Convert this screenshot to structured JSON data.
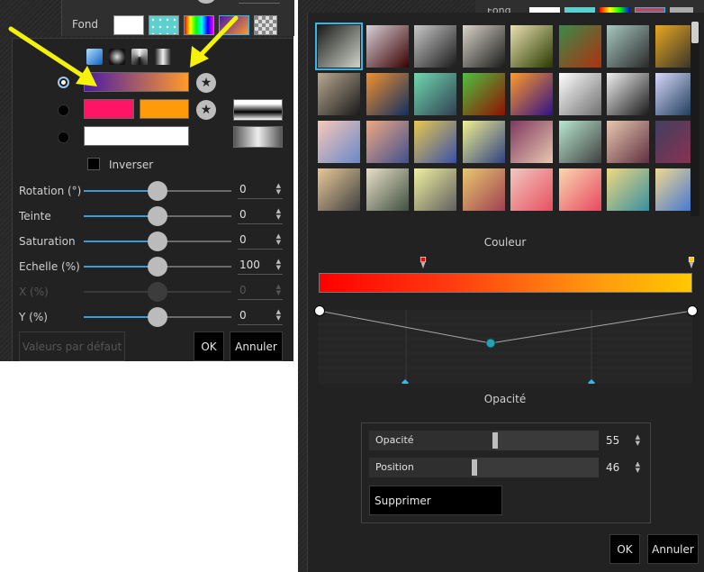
{
  "left": {
    "background_label": "Fond",
    "gradient_types": [
      "linear-gradient-icon",
      "radial-gradient-icon",
      "conical-gradient-icon",
      "reflected-gradient-icon"
    ],
    "invert_label": "Inverser",
    "sliders": [
      {
        "label": "Rotation (°)",
        "value": "0",
        "fraction": 0.5,
        "enabled": true
      },
      {
        "label": "Teinte",
        "value": "0",
        "fraction": 0.5,
        "enabled": true
      },
      {
        "label": "Saturation",
        "value": "0",
        "fraction": 0.5,
        "enabled": true
      },
      {
        "label": "Echelle (%)",
        "value": "100",
        "fraction": 0.5,
        "enabled": true
      },
      {
        "label": "X (%)",
        "value": "0",
        "fraction": 0.5,
        "enabled": false
      },
      {
        "label": "Y (%)",
        "value": "0",
        "fraction": 0.5,
        "enabled": true
      }
    ],
    "default_button": "Valeurs par défaut",
    "ok_button": "OK",
    "cancel_button": "Annuler",
    "colors": {
      "gradient_start": "#4a1aa8",
      "gradient_end": "#ff9a2a",
      "color_pink": "#ff1466",
      "color_orange": "#ff9a0a",
      "slider_accent": "#3b9bd8",
      "arrow": "#f5f20a"
    }
  },
  "right": {
    "color_label": "Couleur",
    "opacity_label": "Opacité",
    "stop_props": {
      "opacity_label": "Opacité",
      "opacity_value": "55",
      "opacity_fraction": 0.55,
      "position_label": "Position",
      "position_value": "46",
      "position_fraction": 0.46
    },
    "delete_button": "Supprimer",
    "ok_button": "OK",
    "cancel_button": "Annuler",
    "gradient_stops": [
      "#ff0000",
      "#ffc800"
    ],
    "presets": [
      [
        "#cfd4c8",
        "#1a1a1a"
      ],
      [
        "#3a0000",
        "#d8d0d8"
      ],
      [
        "#1a1a1a",
        "#c8c8c8"
      ],
      [
        "#1a1a1a",
        "#d8d4c8"
      ],
      [
        "#2a3a00",
        "#e8e0b0"
      ],
      [
        "#b03010",
        "#3a8a4a"
      ],
      [
        "#2a2a2a",
        "#a8c8c0"
      ],
      [
        "#2a2a2a",
        "#e8a820"
      ],
      [
        "#1a1a1a",
        "#b8a890"
      ],
      [
        "#103060",
        "#f09030"
      ],
      [
        "#304050",
        "#70d8b0"
      ],
      [
        "#901000",
        "#50c040"
      ],
      [
        "#301088",
        "#ff9a2a"
      ],
      [
        "#707070",
        "#ffffff"
      ],
      [
        "#1a1a1a",
        "#f0f0f0"
      ],
      [
        "#103050",
        "#d8d8f8"
      ],
      [
        "#6888c8",
        "#f8c8b8"
      ],
      [
        "#405090",
        "#f0a880"
      ],
      [
        "#3850a8",
        "#e8c850"
      ],
      [
        "#304080",
        "#f0f090"
      ],
      [
        "#e8c8b0",
        "#803860"
      ],
      [
        "#404040",
        "#b8e8d0"
      ],
      [
        "#603040",
        "#e8c8b0"
      ],
      [
        "#903050",
        "#404060"
      ],
      [
        "#404040",
        "#e8c898"
      ],
      [
        "#405040",
        "#e8e0c8"
      ],
      [
        "#606060",
        "#f0f0a0"
      ],
      [
        "#a04050",
        "#e8c870"
      ],
      [
        "#e85060",
        "#f0c8c0"
      ],
      [
        "#e84860",
        "#f8d8b0"
      ],
      [
        "#3890a0",
        "#f0d880"
      ],
      [
        "#3870d8",
        "#f0d890"
      ]
    ]
  }
}
